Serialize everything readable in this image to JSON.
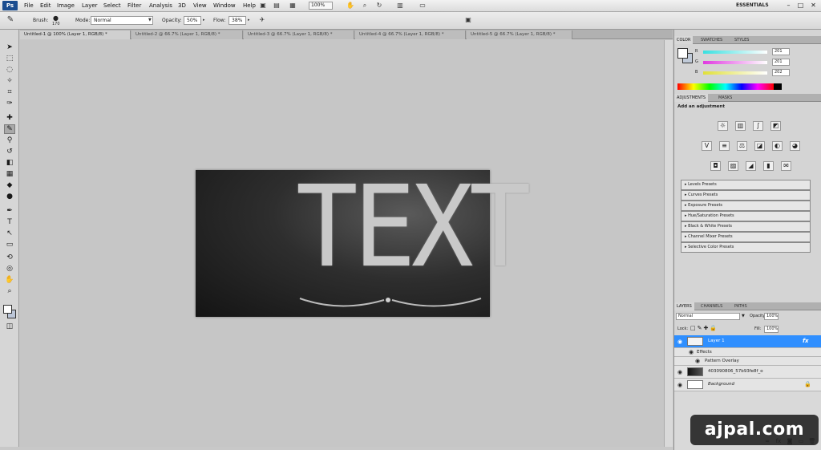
{
  "app": {
    "logo": "Ps"
  },
  "menu": [
    "File",
    "Edit",
    "Image",
    "Layer",
    "Select",
    "Filter",
    "Analysis",
    "3D",
    "View",
    "Window",
    "Help"
  ],
  "menubar": {
    "zoom": "100%",
    "workspace": "ESSENTIALS",
    "window_controls": [
      "–",
      "□",
      "✕"
    ]
  },
  "options": {
    "brush_label": "Brush:",
    "brush_size": "170",
    "mode_label": "Mode:",
    "mode_value": "Normal",
    "opacity_label": "Opacity:",
    "opacity_value": "50%",
    "flow_label": "Flow:",
    "flow_value": "38%"
  },
  "tabs": [
    "Untitled-1 @ 100% (Layer 1, RGB/8) *",
    "Untitled-2 @ 66.7% (Layer 1, RGB/8) *",
    "Untitled-3 @ 66.7% (Layer 1, RGB/8) *",
    "Untitled-4 @ 66.7% (Layer 1, RGB/8) *",
    "Untitled-5 @ 66.7% (Layer 1, RGB/8) *"
  ],
  "canvas": {
    "text": "TEXT"
  },
  "color_panel": {
    "tabs": [
      "COLOR",
      "SWATCHES",
      "STYLES"
    ],
    "channels": [
      {
        "label": "R",
        "value": "201",
        "color": "#e03030"
      },
      {
        "label": "G",
        "value": "201",
        "color": "#30c030"
      },
      {
        "label": "B",
        "value": "202",
        "color": "#3060e0"
      }
    ]
  },
  "adjustments_panel": {
    "tabs": [
      "ADJUSTMENTS",
      "MASKS"
    ],
    "heading": "Add an adjustment",
    "presets": [
      "Levels Presets",
      "Curves Presets",
      "Exposure Presets",
      "Hue/Saturation Presets",
      "Black & White Presets",
      "Channel Mixer Presets",
      "Selective Color Presets"
    ]
  },
  "layers_panel": {
    "tabs": [
      "LAYERS",
      "CHANNELS",
      "PATHS"
    ],
    "blend_mode": "Normal",
    "opacity_label": "Opacity:",
    "opacity_value": "100%",
    "lock_label": "Lock:",
    "fill_label": "Fill:",
    "fill_value": "100%",
    "layers": [
      {
        "name": "Layer 1",
        "selected": true
      },
      {
        "name": "Effects"
      },
      {
        "name": "Pattern Overlay"
      },
      {
        "name": "403090806_57b93fe8f_o"
      },
      {
        "name": "Background"
      }
    ]
  },
  "watermark": "ajpal.com",
  "colors": {
    "selection": "#2f8fff",
    "panel_bg": "#d4d4d4",
    "canvas_bg": "#c6c6c6"
  }
}
